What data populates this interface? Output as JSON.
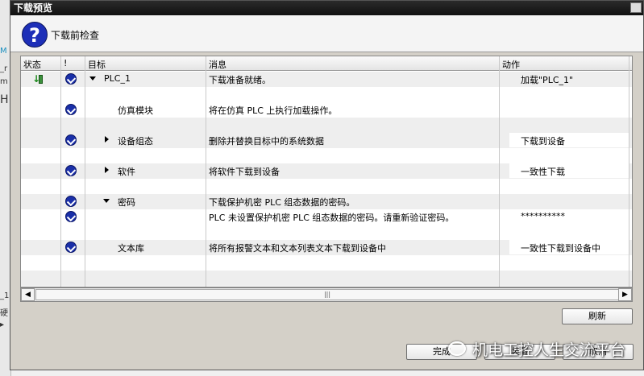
{
  "dialog": {
    "title": "下载预览",
    "header_text": "下载前检查",
    "columns": {
      "status": "状态",
      "bang": "!",
      "target": "目标",
      "message": "消息",
      "action": "动作"
    },
    "rows": [
      {
        "target": "PLC_1",
        "message": "下载准备就绪。",
        "action": "加载\"PLC_1\"",
        "status_icon": "download-ready-icon",
        "expand": "down"
      },
      {
        "target": "仿真模块",
        "message": "将在仿真 PLC 上执行加载操作。",
        "action": ""
      },
      {
        "target": "设备组态",
        "message": "删除并替换目标中的系统数据",
        "action": "下载到设备",
        "expand": "right"
      },
      {
        "target": "软件",
        "message": "将软件下载到设备",
        "action": "一致性下载",
        "expand": "right"
      },
      {
        "target": "密码",
        "message": "下载保护机密 PLC 组态数据的密码。",
        "action": "",
        "expand": "down"
      },
      {
        "target": "",
        "message": "PLC 未设置保护机密 PLC 组态数据的密码。请重新验证密码。",
        "action": "**********"
      },
      {
        "target": "文本库",
        "message": "将所有报警文本和文本列表文本下载到设备中",
        "action": "一致性下载到设备中"
      }
    ],
    "refresh_button": "刷新",
    "finish_button": "完成",
    "load_button": "装载",
    "cancel_button": "取消"
  },
  "watermark": "机电工控人生交流平台",
  "background_fragments": [
    "M",
    "_r",
    "m",
    "H",
    "_1",
    "硬",
    "▸"
  ],
  "colors": {
    "check": "#1a2fa8",
    "titlebar": "#1a1a1a",
    "dialog_bg": "#d4d0c8"
  }
}
